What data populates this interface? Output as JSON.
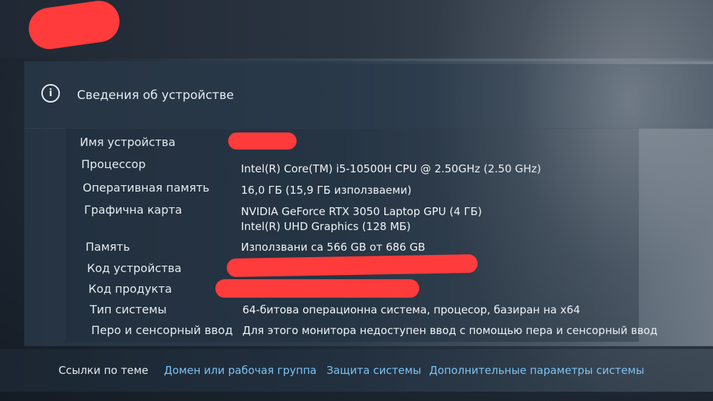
{
  "section": {
    "title": "Сведения об устройстве",
    "icon": "info-icon"
  },
  "specs": {
    "device_name": {
      "label": "Имя устройства",
      "value": ""
    },
    "processor": {
      "label": "Процессор",
      "value": "Intel(R) Core(TM) i5-10500H CPU @ 2.50GHz (2.50 GHz)"
    },
    "ram": {
      "label": "Оперативная память",
      "value": "16,0 ГБ (15,9 ГБ използваеми)"
    },
    "graphics": {
      "label": "Графична карта",
      "value1": "NVIDIA GeForce RTX 3050 Laptop GPU (4 ГБ)",
      "value2": "Intel(R) UHD Graphics (128 МБ)"
    },
    "storage": {
      "label": "Память",
      "value": "Използвани са 566 GB от 686 GB"
    },
    "device_id": {
      "label": "Код устройства",
      "value": ""
    },
    "product_id": {
      "label": "Код продукта",
      "value": ""
    },
    "system_type": {
      "label": "Тип системы",
      "value": "64-битова операционна система, процесор, базиран на x64"
    },
    "pen_touch": {
      "label": "Перо и сенсорный ввод",
      "value": "Для этого монитора недоступен ввод с помощью пера и сенсорный ввод"
    }
  },
  "related": {
    "title": "Ссылки по теме",
    "links": [
      "Домен или рабочая группа",
      "Защита системы",
      "Дополнительные параметры системы"
    ]
  },
  "colors": {
    "redaction": "#ff3b3b",
    "link": "#7cc4f2"
  }
}
